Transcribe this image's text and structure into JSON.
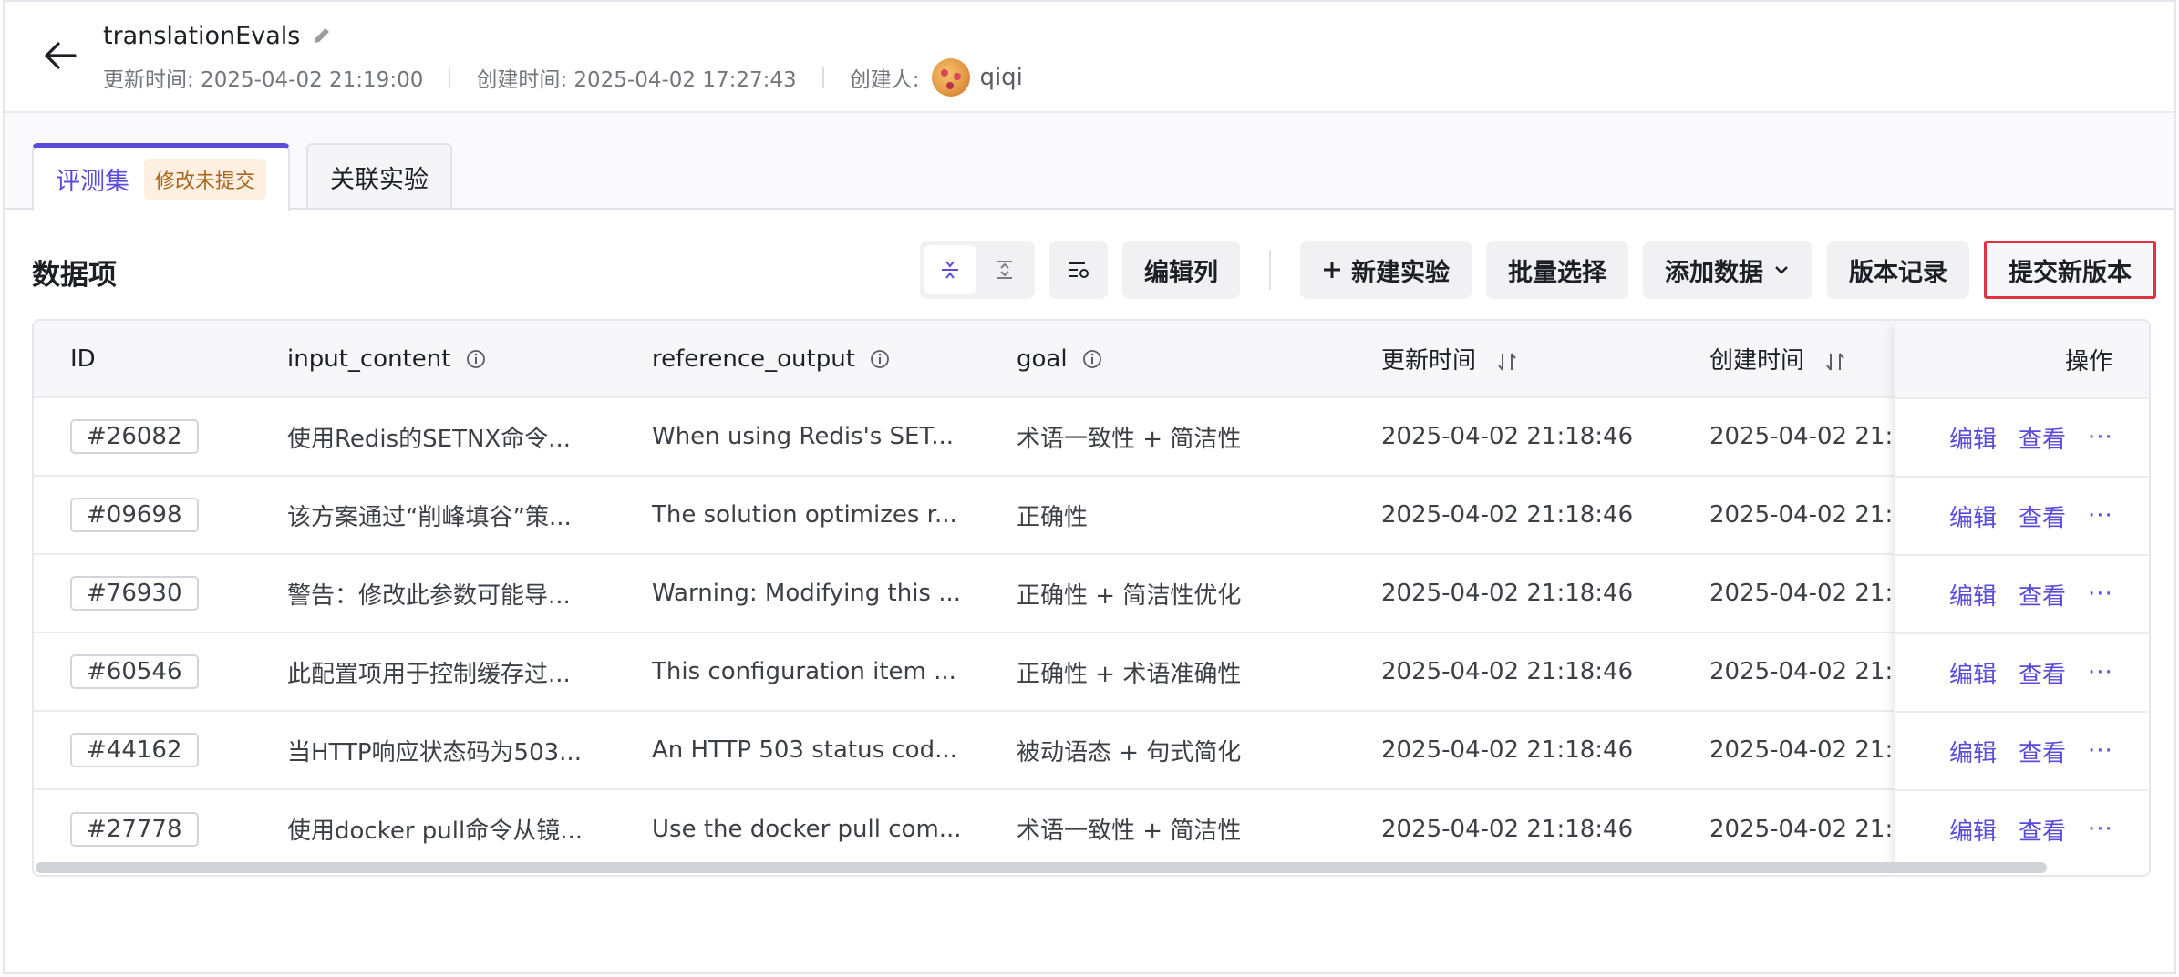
{
  "header": {
    "title": "translationEvals",
    "updated_label": "更新时间: 2025-04-02 21:19:00",
    "created_label": "创建时间: 2025-04-02 17:27:43",
    "creator_label": "创建人:",
    "creator_name": "qiqi"
  },
  "tabs": [
    {
      "label": "评测集",
      "badge": "修改未提交",
      "active": true
    },
    {
      "label": "关联实验",
      "active": false
    }
  ],
  "section": {
    "title": "数据项"
  },
  "toolbar": {
    "edit_columns": "编辑列",
    "new_experiment": "新建实验",
    "batch_select": "批量选择",
    "add_data": "添加数据",
    "version_history": "版本记录",
    "submit_version": "提交新版本"
  },
  "table": {
    "columns": [
      "ID",
      "input_content",
      "reference_output",
      "goal",
      "更新时间",
      "创建时间",
      "操作"
    ],
    "row_actions": {
      "edit": "编辑",
      "view": "查看",
      "more": "···"
    },
    "rows": [
      {
        "id": "#26082",
        "input": "使用Redis的SETNX命令...",
        "reference": "When using Redis's SET...",
        "goal": "术语一致性 + 简洁性",
        "updated": "2025-04-02 21:18:46",
        "created": "2025-04-02 21:1"
      },
      {
        "id": "#09698",
        "input": "该方案通过“削峰填谷”策...",
        "reference": "The solution optimizes r...",
        "goal": "正确性",
        "updated": "2025-04-02 21:18:46",
        "created": "2025-04-02 21:1"
      },
      {
        "id": "#76930",
        "input": "警告：修改此参数可能导...",
        "reference": "Warning: Modifying this ...",
        "goal": "正确性 + 简洁性优化",
        "updated": "2025-04-02 21:18:46",
        "created": "2025-04-02 21:1"
      },
      {
        "id": "#60546",
        "input": "此配置项用于控制缓存过...",
        "reference": "This configuration item ...",
        "goal": "正确性 + 术语准确性",
        "updated": "2025-04-02 21:18:46",
        "created": "2025-04-02 21:1"
      },
      {
        "id": "#44162",
        "input": "当HTTP响应状态码为503...",
        "reference": "An HTTP 503 status cod...",
        "goal": "被动语态 + 句式简化",
        "updated": "2025-04-02 21:18:46",
        "created": "2025-04-02 21:1"
      },
      {
        "id": "#27778",
        "input": "使用docker pull命令从镜...",
        "reference": "Use the docker pull com...",
        "goal": "术语一致性 + 简洁性",
        "updated": "2025-04-02 21:18:46",
        "created": "2025-04-02 21:1"
      }
    ]
  },
  "colors": {
    "accent": "#5a4cdb",
    "badge_bg": "#fdf0e1",
    "badge_text": "#a8671f",
    "highlight_border": "#e0323e"
  }
}
